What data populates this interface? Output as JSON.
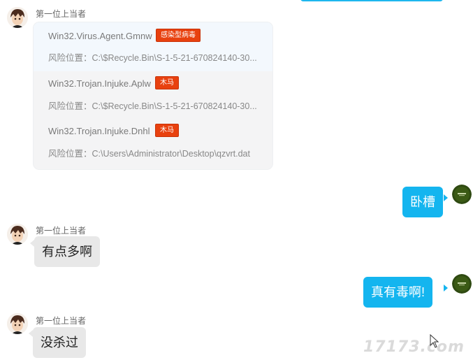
{
  "chat": {
    "sender_name": "第一位上当者",
    "virus_results": [
      {
        "name": "Win32.Virus.Agent.Gmnw",
        "tag": "感染型病毒",
        "location_label": "风险位置：",
        "location": "C:\\$Recycle.Bin\\S-1-5-21-670824140-30..."
      },
      {
        "name": "Win32.Trojan.Injuke.Aplw",
        "tag": "木马",
        "location_label": "风险位置：",
        "location": "C:\\$Recycle.Bin\\S-1-5-21-670824140-30..."
      },
      {
        "name": "Win32.Trojan.Injuke.Dnhl",
        "tag": "木马",
        "location_label": "风险位置：",
        "location": "C:\\Users\\Administrator\\Desktop\\qzvrt.dat"
      }
    ],
    "messages": {
      "out_1": "卧槽",
      "in_1": "有点多啊",
      "out_2": "真有毒啊!",
      "in_2": "没杀过"
    }
  },
  "watermark": "17173.com",
  "colors": {
    "outgoing_bubble": "#14b5ef",
    "incoming_bubble": "#e8e8e8",
    "tag": "#e8410f"
  }
}
